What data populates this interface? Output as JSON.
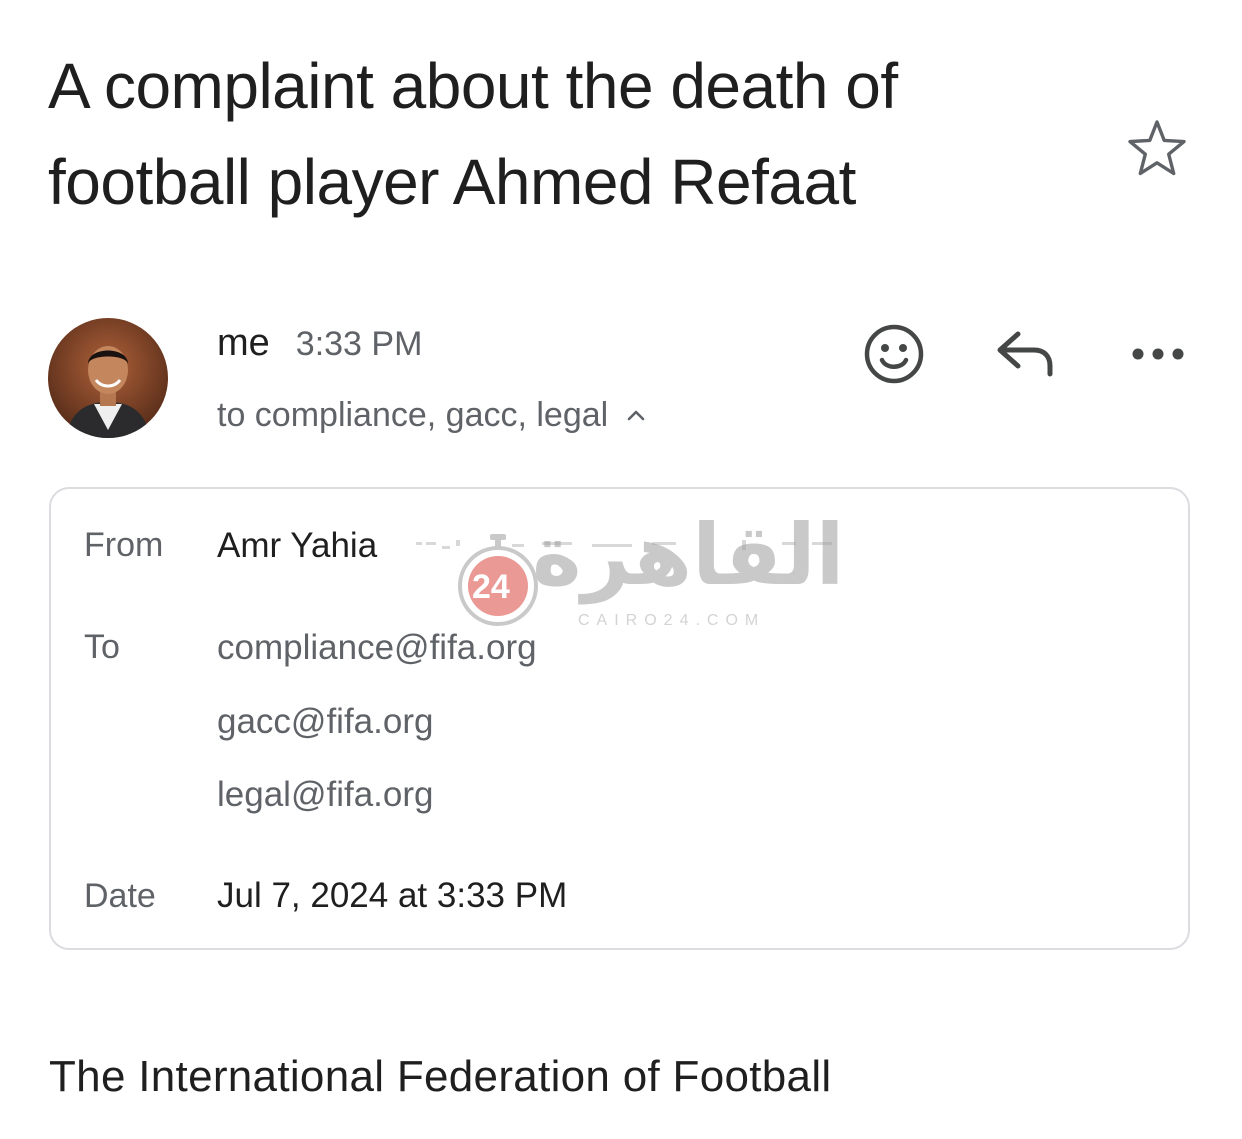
{
  "email": {
    "subject": "A complaint about the death of football player Ahmed Refaat",
    "sender": {
      "name": "me",
      "time": "3:33 PM",
      "recipients_summary": "to compliance, gacc, legal"
    },
    "details": {
      "from_label": "From",
      "from_name": "Amr Yahia",
      "to_label": "To",
      "to_addresses": [
        "compliance@fifa.org",
        "gacc@fifa.org",
        "legal@fifa.org"
      ],
      "date_label": "Date",
      "date_value": "Jul 7, 2024 at 3:33 PM"
    },
    "body_first_line": "The International Federation of Football"
  },
  "watermark": {
    "arabic": "القاهرة",
    "badge": "24",
    "sub": "CAIRO24.COM"
  },
  "icons": {
    "star": "star-outline-icon",
    "emoji": "add-reaction-icon",
    "reply": "reply-icon",
    "more": "more-horizontal-icon",
    "caret": "chevron-up-icon"
  },
  "colors": {
    "text_primary": "#1f1f1f",
    "text_secondary": "#5f6368",
    "border": "#dadce0",
    "watermark_red": "#d9473f"
  }
}
